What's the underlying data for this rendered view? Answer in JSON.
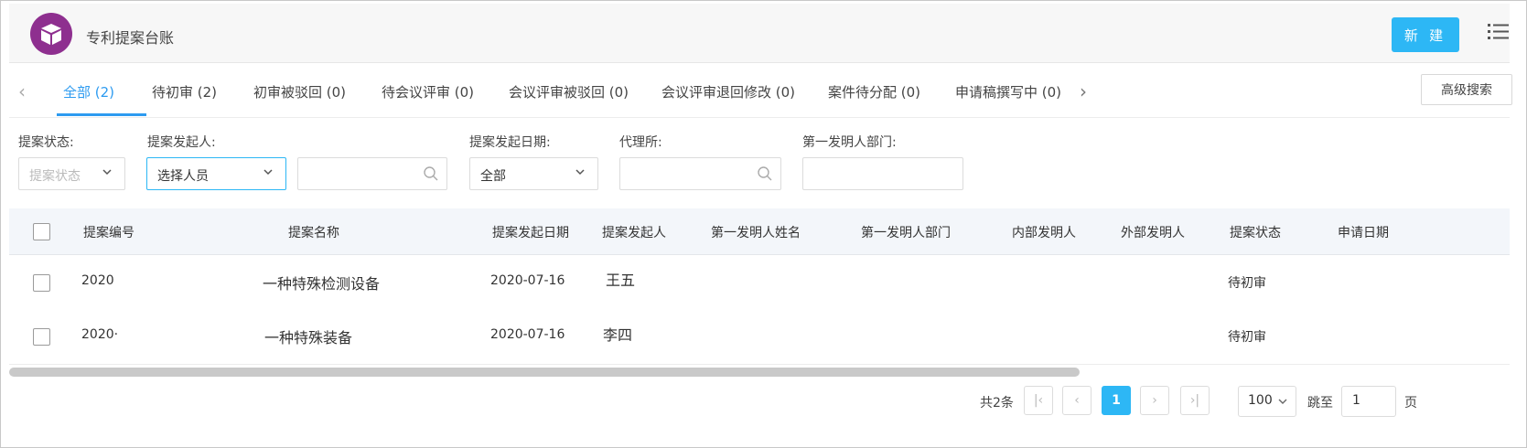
{
  "header": {
    "title": "专利提案台账",
    "new_button": "新 建"
  },
  "tabs": {
    "items": [
      {
        "label": "全部 (2)"
      },
      {
        "label": "待初审 (2)"
      },
      {
        "label": "初审被驳回 (0)"
      },
      {
        "label": "待会议评审 (0)"
      },
      {
        "label": "会议评审被驳回 (0)"
      },
      {
        "label": "会议评审退回修改 (0)"
      },
      {
        "label": "案件待分配 (0)"
      },
      {
        "label": "申请稿撰写中 (0)"
      }
    ],
    "advanced_search": "高级搜索"
  },
  "filters": {
    "status_label": "提案状态:",
    "status_placeholder": "提案状态",
    "initiator_label": "提案发起人:",
    "initiator_value": "选择人员",
    "date_label": "提案发起日期:",
    "date_value": "全部",
    "agency_label": "代理所:",
    "dept_label": "第一发明人部门:"
  },
  "table": {
    "columns": [
      "提案编号",
      "提案名称",
      "提案发起日期",
      "提案发起人",
      "第一发明人姓名",
      "第一发明人部门",
      "内部发明人",
      "外部发明人",
      "提案状态",
      "申请日期"
    ],
    "rows": [
      {
        "id": "2020",
        "name": "一种特殊检测设备",
        "date": "2020-07-16",
        "initiator": "王五",
        "status": "待初审"
      },
      {
        "id": "2020·",
        "name": "一种特殊装备",
        "date": "2020-07-16",
        "initiator": "李四",
        "status": "待初审"
      }
    ]
  },
  "pagination": {
    "total": "共2条",
    "current": "1",
    "page_size": "100",
    "jump_label": "跳至",
    "jump_value": "1",
    "page_suffix": "页"
  }
}
